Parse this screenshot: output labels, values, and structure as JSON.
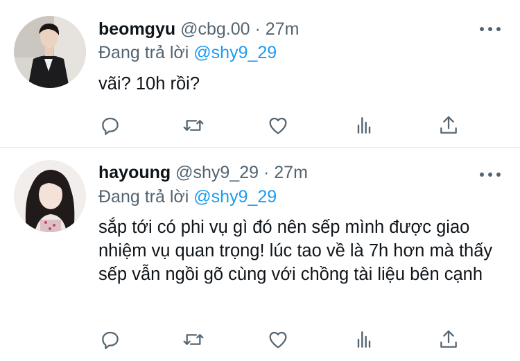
{
  "tweets": [
    {
      "name": "beomgyu",
      "handle": "@cbg.00",
      "separator": "·",
      "time": "27m",
      "reply_prefix": "Đang trả lời",
      "reply_to": "@shy9_29",
      "text": "vãi? 10h rồi?"
    },
    {
      "name": "hayoung",
      "handle": "@shy9_29",
      "separator": "·",
      "time": "27m",
      "reply_prefix": "Đang trả lời",
      "reply_to": "@shy9_29",
      "text": "sắp tới có phi vụ gì đó nên sếp mình được giao nhiệm vụ quan trọng! lúc tao về là 7h hơn mà thấy sếp vẫn ngồi gõ cùng với chồng tài liệu bên cạnh"
    }
  ],
  "colors": {
    "text": "#0f1419",
    "secondary": "#536471",
    "mention": "#1d9bf0",
    "divider": "#e1e4e8"
  },
  "icons": [
    "reply-icon",
    "retweet-icon",
    "like-icon",
    "analytics-icon",
    "share-icon",
    "more-icon"
  ]
}
